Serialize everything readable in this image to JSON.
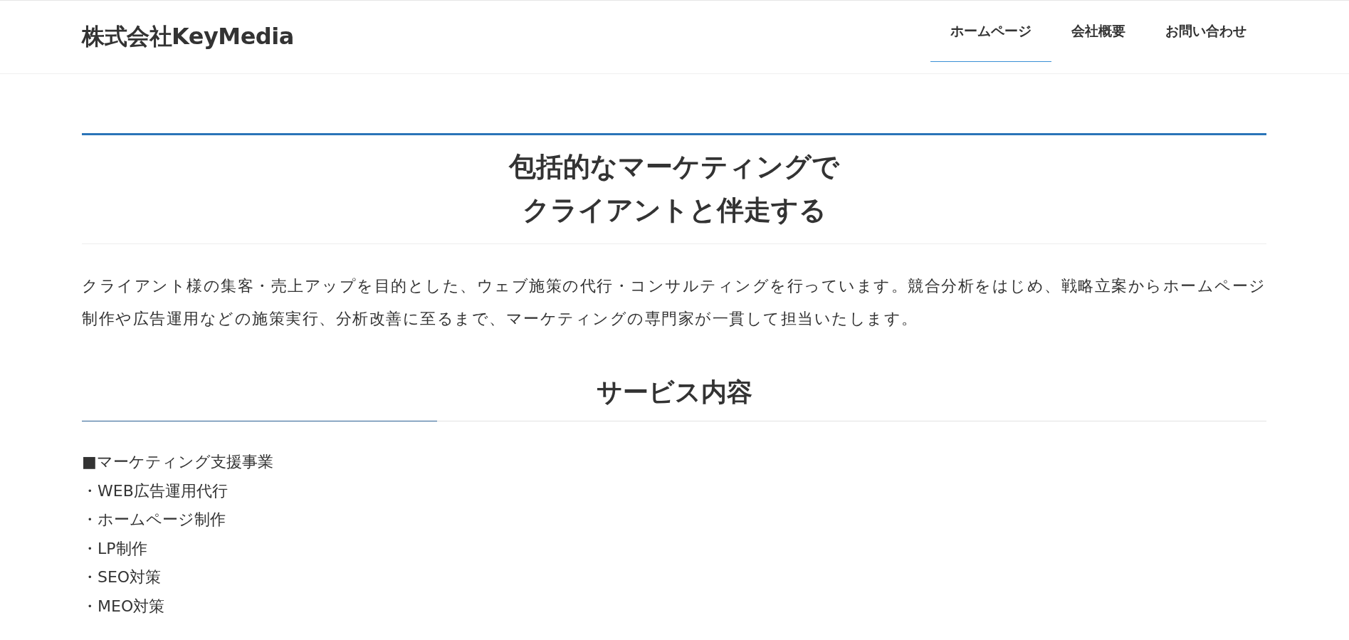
{
  "header": {
    "logo": "株式会社KeyMedia",
    "nav": [
      {
        "label": "ホームページ",
        "selected": true
      },
      {
        "label": "会社概要",
        "selected": false
      },
      {
        "label": "お問い合わせ",
        "selected": false
      }
    ]
  },
  "hero": {
    "title_lines": [
      "包括的なマーケティングで",
      "クライアントと伴走する"
    ],
    "description": "クライアント様の集客・売上アップを目的とした、ウェブ施策の代行・コンサルティングを行っています。競合分析をはじめ、戦略立案からホームページ制作や広告運用などの施策実行、分析改善に至るまで、マーケティングの専門家が一貫して担当いたします。"
  },
  "services": {
    "heading": "サービス内容",
    "items": [
      "■マーケティング支援事業",
      "・WEB広告運用代行",
      "・ホームページ制作",
      "・LP制作",
      "・SEO対策",
      "・MEO対策"
    ]
  }
}
